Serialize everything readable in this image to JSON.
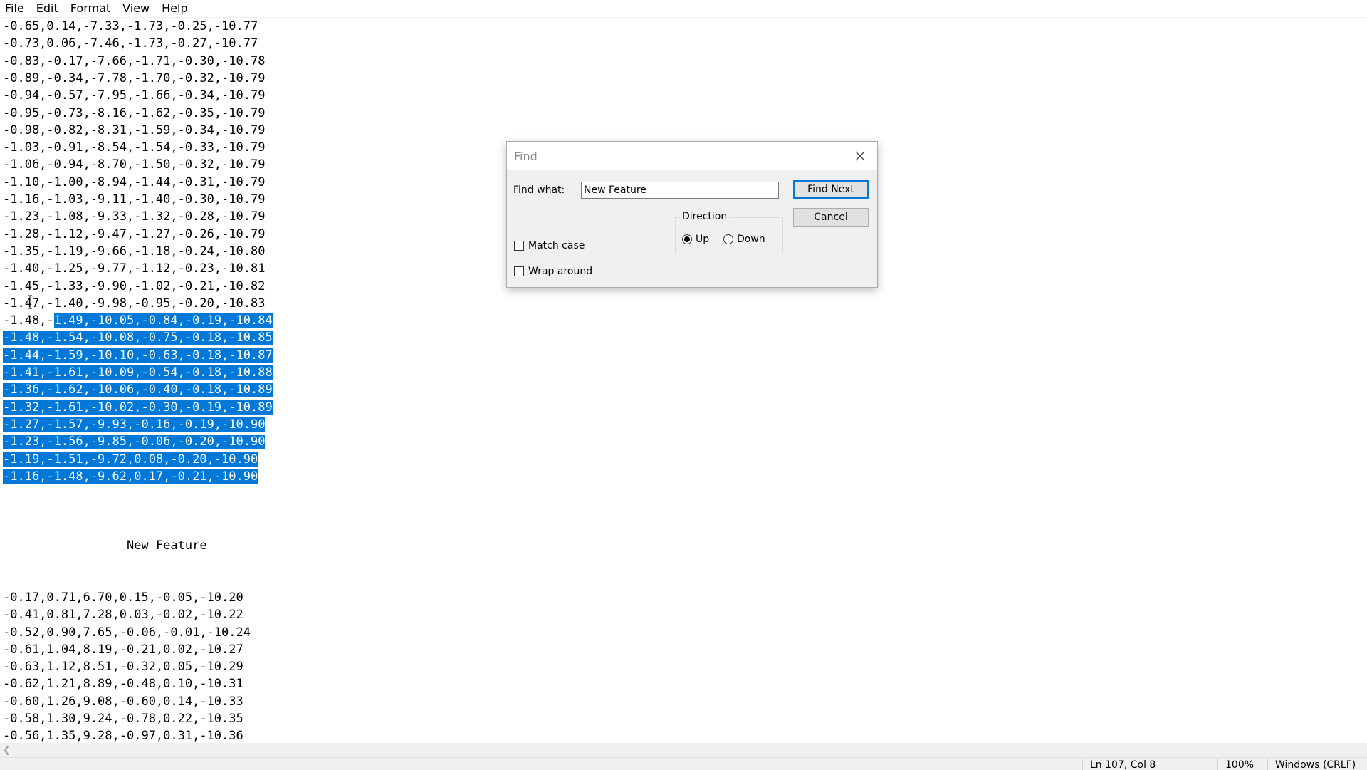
{
  "menu": [
    "File",
    "Edit",
    "Format",
    "View",
    "Help"
  ],
  "editor": {
    "lines_top": [
      "-0.65,0.14,-7.33,-1.73,-0.25,-10.77",
      "-0.73,0.06,-7.46,-1.73,-0.27,-10.77",
      "-0.83,-0.17,-7.66,-1.71,-0.30,-10.78",
      "-0.89,-0.34,-7.78,-1.70,-0.32,-10.79",
      "-0.94,-0.57,-7.95,-1.66,-0.34,-10.79",
      "-0.95,-0.73,-8.16,-1.62,-0.35,-10.79",
      "-0.98,-0.82,-8.31,-1.59,-0.34,-10.79",
      "-1.03,-0.91,-8.54,-1.54,-0.33,-10.79",
      "-1.06,-0.94,-8.70,-1.50,-0.32,-10.79",
      "-1.10,-1.00,-8.94,-1.44,-0.31,-10.79",
      "-1.16,-1.03,-9.11,-1.40,-0.30,-10.79",
      "-1.23,-1.08,-9.33,-1.32,-0.28,-10.79",
      "-1.28,-1.12,-9.47,-1.27,-0.26,-10.79",
      "-1.35,-1.19,-9.66,-1.18,-0.24,-10.80",
      "-1.40,-1.25,-9.77,-1.12,-0.23,-10.81",
      "-1.45,-1.33,-9.90,-1.02,-0.21,-10.82",
      "-1.47,-1.40,-9.98,-0.95,-0.20,-10.83"
    ],
    "partial_line_unselected": "-1.48,-",
    "partial_line_selected": "1.49,-10.05,-0.84,-0.19,-10.84",
    "lines_selected": [
      "-1.48,-1.54,-10.08,-0.75,-0.18,-10.85",
      "-1.44,-1.59,-10.10,-0.63,-0.18,-10.87",
      "-1.41,-1.61,-10.09,-0.54,-0.18,-10.88",
      "-1.36,-1.62,-10.06,-0.40,-0.18,-10.89",
      "-1.32,-1.61,-10.02,-0.30,-0.19,-10.89",
      "-1.27,-1.57,-9.93,-0.16,-0.19,-10.90",
      "-1.23,-1.56,-9.85,-0.06,-0.20,-10.90",
      "-1.19,-1.51,-9.72,0.08,-0.20,-10.90",
      "-1.16,-1.48,-9.62,0.17,-0.21,-10.90"
    ],
    "heading": "New Feature",
    "lines_bottom": [
      "-0.17,0.71,6.70,0.15,-0.05,-10.20",
      "-0.41,0.81,7.28,0.03,-0.02,-10.22",
      "-0.52,0.90,7.65,-0.06,-0.01,-10.24",
      "-0.61,1.04,8.19,-0.21,0.02,-10.27",
      "-0.63,1.12,8.51,-0.32,0.05,-10.29",
      "-0.62,1.21,8.89,-0.48,0.10,-10.31",
      "-0.60,1.26,9.08,-0.60,0.14,-10.33",
      "-0.58,1.30,9.24,-0.78,0.22,-10.35",
      "-0.56,1.35,9.28,-0.97,0.31,-10.36"
    ]
  },
  "find_dialog": {
    "title": "Find",
    "find_what_label": "Find what:",
    "find_what_value": "New Feature",
    "find_next_label": "Find Next",
    "cancel_label": "Cancel",
    "direction_label": "Direction",
    "up_label": "Up",
    "down_label": "Down",
    "direction_selected": "Up",
    "match_case_label": "Match case",
    "match_case_checked": false,
    "wrap_around_label": "Wrap around",
    "wrap_around_checked": false
  },
  "status_bar": {
    "position": "Ln 107, Col 8",
    "zoom": "100%",
    "line_ending": "Windows (CRLF)"
  },
  "colors": {
    "selection": "#0078d7",
    "dialog_bg": "#f0f0f0",
    "default_button_border": "#0078d7"
  }
}
